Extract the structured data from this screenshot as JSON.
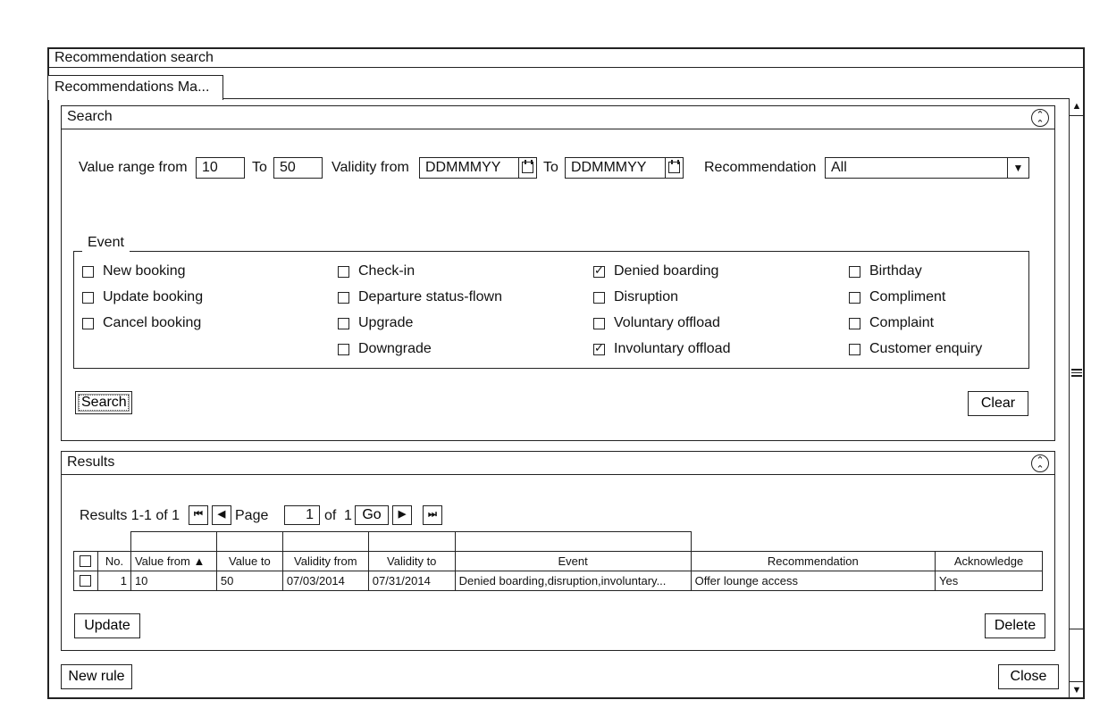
{
  "window": {
    "title": "Recommendation search",
    "tab_label": "Recommendations Ma..."
  },
  "search_panel": {
    "title": "Search",
    "collapse_icon": "double-chevron-up-icon",
    "value_range_from_label": "Value range from",
    "value_from": "10",
    "to_label": "To",
    "value_to": "50",
    "validity_from_label": "Validity from",
    "validity_from_placeholder": "DDMMMYY",
    "validity_to_label": "To",
    "validity_to_placeholder": "DDMMMYY",
    "recommendation_label": "Recommendation",
    "recommendation_selected": "All",
    "event_group": {
      "legend": "Event",
      "columns": [
        [
          {
            "label": "New booking",
            "checked": false
          },
          {
            "label": "Update booking",
            "checked": false
          },
          {
            "label": "Cancel booking",
            "checked": false
          }
        ],
        [
          {
            "label": "Check-in",
            "checked": false
          },
          {
            "label": "Departure status-flown",
            "checked": false
          },
          {
            "label": "Upgrade",
            "checked": false
          },
          {
            "label": "Downgrade",
            "checked": false
          }
        ],
        [
          {
            "label": "Denied boarding",
            "checked": true
          },
          {
            "label": "Disruption",
            "checked": false
          },
          {
            "label": "Voluntary offload",
            "checked": false
          },
          {
            "label": "Involuntary offload",
            "checked": true
          }
        ],
        [
          {
            "label": "Birthday",
            "checked": false
          },
          {
            "label": "Compliment",
            "checked": false
          },
          {
            "label": "Complaint",
            "checked": false
          },
          {
            "label": "Customer enquiry",
            "checked": false
          }
        ]
      ]
    },
    "search_button": "Search",
    "clear_button": "Clear"
  },
  "results_panel": {
    "title": "Results",
    "collapse_icon": "double-chevron-up-icon",
    "summary": "Results 1-1 of 1",
    "page_label": "Page",
    "page_value": "1",
    "of_label": "of",
    "total_pages": "1",
    "go_button": "Go",
    "pager_icons": {
      "first": "⏮",
      "prev": "◀",
      "next": "▶",
      "last": "⏭"
    },
    "table": {
      "columns": [
        "No.",
        "Value from",
        "Value to",
        "Validity from",
        "Validity to",
        "Event",
        "Recommendation",
        "Acknowledge"
      ],
      "sort_column": "Value from",
      "sort_direction": "ascending",
      "rows": [
        {
          "checked": false,
          "no": "1",
          "value_from": "10",
          "value_to": "50",
          "validity_from": "07/03/2014",
          "validity_to": "07/31/2014",
          "event": "Denied boarding,disruption,involuntary...",
          "recommendation": "Offer lounge access",
          "acknowledge": "Yes"
        }
      ]
    },
    "update_button": "Update",
    "delete_button": "Delete"
  },
  "footer": {
    "new_rule_button": "New rule",
    "close_button": "Close"
  },
  "scrollbar": {
    "up_arrow": "▲",
    "down_arrow": "▼"
  }
}
